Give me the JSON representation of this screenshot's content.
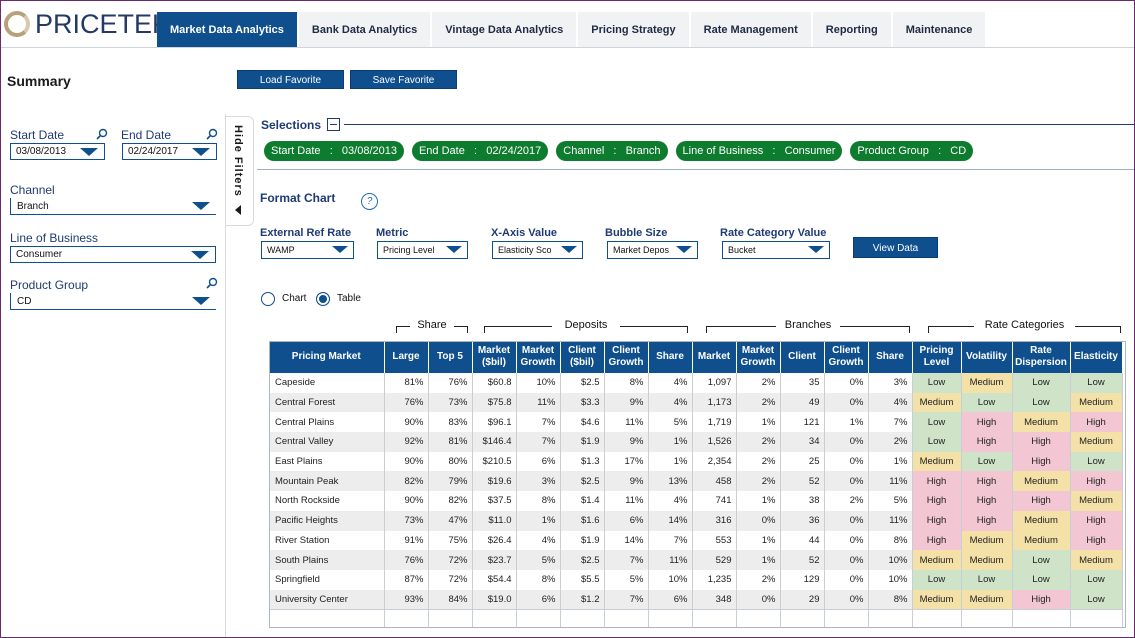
{
  "brand": {
    "name_a": "PRICE",
    "name_b": "TEK"
  },
  "nav": {
    "tabs": [
      {
        "label": "Market Data Analytics",
        "active": true
      },
      {
        "label": "Bank Data Analytics"
      },
      {
        "label": "Vintage Data Analytics"
      },
      {
        "label": "Pricing Strategy"
      },
      {
        "label": "Rate Management"
      },
      {
        "label": "Reporting"
      },
      {
        "label": "Maintenance"
      }
    ]
  },
  "summary": {
    "title": "Summary"
  },
  "toolbar": {
    "load_favorite": "Load Favorite",
    "save_favorite": "Save Favorite"
  },
  "filters": {
    "start_date_label": "Start Date",
    "start_date_value": "03/08/2013",
    "end_date_label": "End Date",
    "end_date_value": "02/24/2017",
    "channel_label": "Channel",
    "channel_value": "Branch",
    "lob_label": "Line of Business",
    "lob_value": "Consumer",
    "product_group_label": "Product Group",
    "product_group_value": "CD",
    "hide_filters": "Hide Filters"
  },
  "selections": {
    "title": "Selections",
    "pills": [
      "Start Date   :   03/08/2013",
      "End Date   :   02/24/2017",
      "Channel   :   Branch",
      "Line of Business   :   Consumer",
      "Product Group   :   CD"
    ]
  },
  "format_chart": {
    "title": "Format Chart",
    "help_glyph": "?",
    "external_ref_rate": {
      "label": "External Ref Rate",
      "value": "WAMP"
    },
    "metric": {
      "label": "Metric",
      "value": "Pricing Level"
    },
    "x_axis_value": {
      "label": "X-Axis Value",
      "value": "Elasticity Sco"
    },
    "bubble_size": {
      "label": "Bubble Size",
      "value": "Market Depos"
    },
    "rate_category_value": {
      "label": "Rate Category Value",
      "value": "Bucket"
    },
    "view_data": "View Data",
    "view_chart": "Chart",
    "view_table": "Table",
    "selected_view": "Table"
  },
  "table": {
    "groups": [
      "Share",
      "Deposits",
      "Branches",
      "Rate Categories"
    ],
    "columns": [
      "Pricing Market",
      "Large",
      "Top 5",
      "Market ($bil)",
      "Market Growth",
      "Client ($bil)",
      "Client Growth",
      "Share",
      "Market",
      "Market Growth",
      "Client",
      "Client Growth",
      "Share",
      "Pricing Level",
      "Volatility",
      "Rate Dispersion",
      "Elasticity"
    ],
    "rows": [
      [
        "Capeside",
        "81%",
        "76%",
        "$60.8",
        "10%",
        "$2.5",
        "8%",
        "4%",
        "1,097",
        "2%",
        "35",
        "0%",
        "3%",
        "Low",
        "Medium",
        "Low",
        "Low"
      ],
      [
        "Central Forest",
        "76%",
        "73%",
        "$75.8",
        "11%",
        "$3.3",
        "9%",
        "4%",
        "1,173",
        "2%",
        "49",
        "0%",
        "4%",
        "Medium",
        "Low",
        "Low",
        "Medium"
      ],
      [
        "Central Plains",
        "90%",
        "83%",
        "$96.1",
        "7%",
        "$4.6",
        "11%",
        "5%",
        "1,719",
        "1%",
        "121",
        "1%",
        "7%",
        "Low",
        "High",
        "Medium",
        "High"
      ],
      [
        "Central Valley",
        "92%",
        "81%",
        "$146.4",
        "7%",
        "$1.9",
        "9%",
        "1%",
        "1,526",
        "2%",
        "34",
        "0%",
        "2%",
        "Low",
        "High",
        "High",
        "Medium"
      ],
      [
        "East Plains",
        "90%",
        "80%",
        "$210.5",
        "6%",
        "$1.3",
        "17%",
        "1%",
        "2,354",
        "2%",
        "25",
        "0%",
        "1%",
        "Medium",
        "Low",
        "High",
        "Low"
      ],
      [
        "Mountain Peak",
        "82%",
        "79%",
        "$19.6",
        "3%",
        "$2.5",
        "9%",
        "13%",
        "458",
        "2%",
        "52",
        "0%",
        "11%",
        "High",
        "High",
        "Medium",
        "High"
      ],
      [
        "North Rockside",
        "90%",
        "82%",
        "$37.5",
        "8%",
        "$1.4",
        "11%",
        "4%",
        "741",
        "1%",
        "38",
        "2%",
        "5%",
        "High",
        "High",
        "High",
        "Medium"
      ],
      [
        "Pacific Heights",
        "73%",
        "47%",
        "$11.0",
        "1%",
        "$1.6",
        "6%",
        "14%",
        "316",
        "0%",
        "36",
        "0%",
        "11%",
        "High",
        "High",
        "Medium",
        "High"
      ],
      [
        "River Station",
        "91%",
        "75%",
        "$26.4",
        "4%",
        "$1.9",
        "14%",
        "7%",
        "553",
        "1%",
        "44",
        "0%",
        "8%",
        "High",
        "Medium",
        "Medium",
        "High"
      ],
      [
        "South Plains",
        "76%",
        "72%",
        "$23.7",
        "5%",
        "$2.5",
        "7%",
        "11%",
        "529",
        "1%",
        "52",
        "0%",
        "10%",
        "Medium",
        "Medium",
        "Low",
        "Medium"
      ],
      [
        "Springfield",
        "87%",
        "72%",
        "$54.4",
        "8%",
        "$5.5",
        "5%",
        "10%",
        "1,235",
        "2%",
        "129",
        "0%",
        "10%",
        "Low",
        "Low",
        "Low",
        "Low"
      ],
      [
        "University Center",
        "93%",
        "84%",
        "$19.0",
        "6%",
        "$1.2",
        "7%",
        "6%",
        "348",
        "0%",
        "29",
        "0%",
        "8%",
        "Medium",
        "Medium",
        "High",
        "Low"
      ]
    ]
  },
  "colors": {
    "primary": "#0f4f8d",
    "pill": "#0e7c2f",
    "low": "#cfe3c9",
    "medium": "#f3e1a8",
    "high": "#f2c7d3"
  }
}
